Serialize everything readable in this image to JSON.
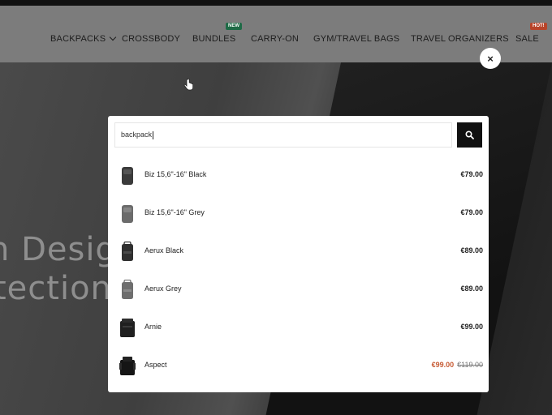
{
  "nav": {
    "items": [
      {
        "label": "BACKPACKS"
      },
      {
        "label": "CROSSBODY"
      },
      {
        "label": "BUNDLES",
        "badge": "NEW"
      },
      {
        "label": "CARRY-ON"
      },
      {
        "label": "GYM/TRAVEL BAGS"
      },
      {
        "label": "TRAVEL ORGANIZERS"
      },
      {
        "label": "SALE",
        "badge": "HOT!"
      }
    ]
  },
  "hero": {
    "line1": "n Design",
    "line2": "tection."
  },
  "close": {
    "label": "×"
  },
  "search": {
    "value": "backpack",
    "button_icon": "search-icon"
  },
  "results": [
    {
      "name": "Biz 15,6\"-16\" Black",
      "price": "€79.00",
      "color": "#3a3a3a"
    },
    {
      "name": "Biz 15,6\"-16\" Grey",
      "price": "€79.00",
      "color": "#6b6b6b"
    },
    {
      "name": "Aerux Black",
      "price": "€89.00",
      "color": "#2f2f2f"
    },
    {
      "name": "Aerux Grey",
      "price": "€89.00",
      "color": "#6e6e6e"
    },
    {
      "name": "Arnie",
      "price": "€99.00",
      "color": "#1f1f1f"
    },
    {
      "name": "Aspect",
      "sale_price": "€99.00",
      "old_price": "€119.00",
      "color": "#151515"
    }
  ],
  "colors": {
    "sale": "#c65a33",
    "badge_new": "#1e6b46",
    "badge_hot": "#b8442a"
  }
}
